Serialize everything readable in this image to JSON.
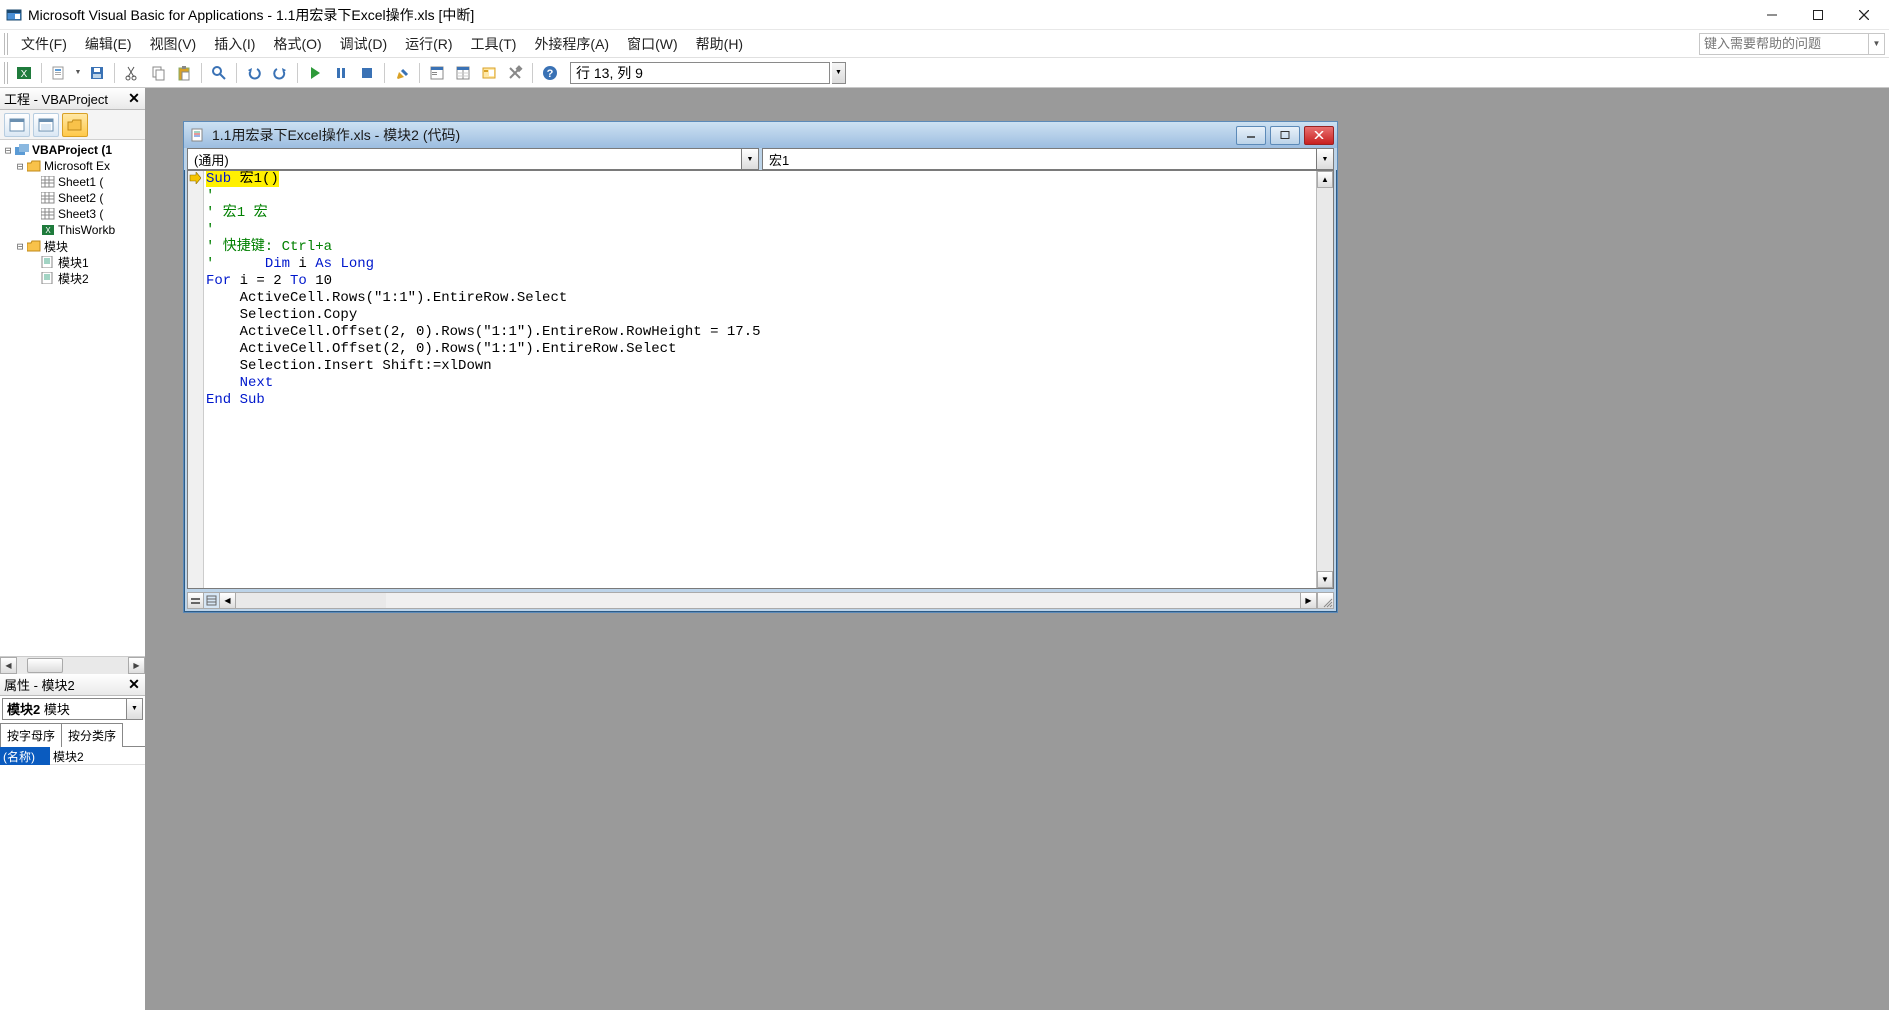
{
  "title": "Microsoft Visual Basic for Applications - 1.1用宏录下Excel操作.xls [中断]",
  "menus": {
    "file": "文件(F)",
    "edit": "编辑(E)",
    "view": "视图(V)",
    "insert": "插入(I)",
    "format": "格式(O)",
    "debug": "调试(D)",
    "run": "运行(R)",
    "tools": "工具(T)",
    "addins": "外接程序(A)",
    "window": "窗口(W)",
    "help": "帮助(H)"
  },
  "help_search_placeholder": "键入需要帮助的问题",
  "cursor_position": "行 13,  列 9",
  "project_pane": {
    "title": "工程 - VBAProject",
    "root": "VBAProject  (1",
    "ms_excel": "Microsoft Ex",
    "sheet1": "Sheet1 (",
    "sheet2": "Sheet2 (",
    "sheet3": "Sheet3 (",
    "thiswb": "ThisWorkb",
    "modules": "模块",
    "module1": "模块1",
    "module2": "模块2"
  },
  "properties_pane": {
    "title": "属性 - 模块2",
    "combo_object": "模块2",
    "combo_type": "模块",
    "tab_alpha": "按字母序",
    "tab_cat": "按分类序",
    "prop_name_label": "(名称)",
    "prop_name_value": "模块2"
  },
  "code_window": {
    "title": "1.1用宏录下Excel操作.xls - 模块2 (代码)",
    "combo_object": "(通用)",
    "combo_proc": "宏1",
    "code": {
      "l1a": "Sub",
      "l1b": " 宏1()",
      "l2": "'",
      "l3": "' 宏1 宏",
      "l4": "'",
      "l5": "' 快捷键: Ctrl+a",
      "l6a": "'      ",
      "l6b": "Dim",
      "l6c": " i ",
      "l6d": "As Long",
      "l7a": "For",
      "l7b": " i = 2 ",
      "l7c": "To",
      "l7d": " 10",
      "l8": "    ActiveCell.Rows(\"1:1\").EntireRow.Select",
      "l9": "    Selection.Copy",
      "l10": "    ActiveCell.Offset(2, 0).Rows(\"1:1\").EntireRow.RowHeight = 17.5",
      "l11": "    ActiveCell.Offset(2, 0).Rows(\"1:1\").EntireRow.Select",
      "l12": "    Selection.Insert Shift:=xlDown",
      "l13a": "    ",
      "l13b": "Next",
      "l14": "End Sub"
    }
  }
}
